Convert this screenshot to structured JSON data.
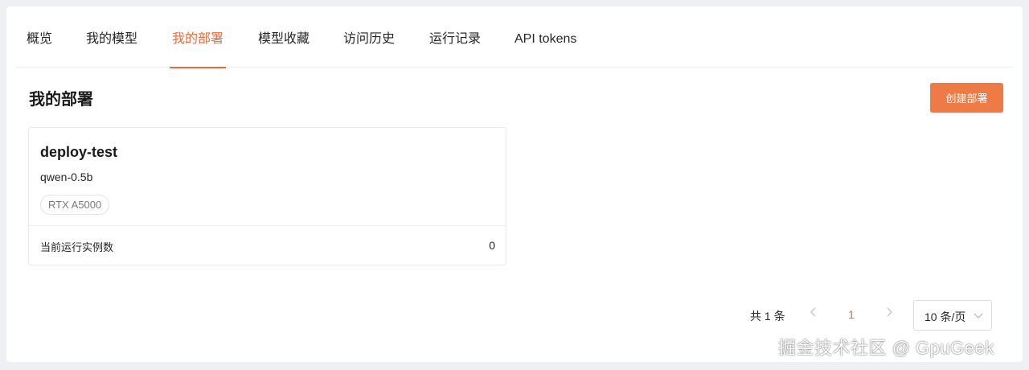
{
  "tabs": [
    {
      "label": "概览",
      "active": false
    },
    {
      "label": "我的模型",
      "active": false
    },
    {
      "label": "我的部署",
      "active": true
    },
    {
      "label": "模型收藏",
      "active": false
    },
    {
      "label": "访问历史",
      "active": false
    },
    {
      "label": "运行记录",
      "active": false
    },
    {
      "label": "API tokens",
      "active": false
    }
  ],
  "page": {
    "title": "我的部署",
    "create_button": "创建部署"
  },
  "deployments": [
    {
      "name": "deploy-test",
      "model": "qwen-0.5b",
      "gpu": "RTX A5000",
      "instances_label": "当前运行实例数",
      "instances": "0"
    }
  ],
  "pagination": {
    "total": "共 1 条",
    "prev_icon": "chevron-left-icon",
    "current_page": "1",
    "next_icon": "chevron-right-icon",
    "page_size": "10 条/页"
  },
  "watermark": "掘金技术社区 @ GpuGeek",
  "colors": {
    "accent": "#ee6a3a",
    "button": "#ee7a45"
  }
}
